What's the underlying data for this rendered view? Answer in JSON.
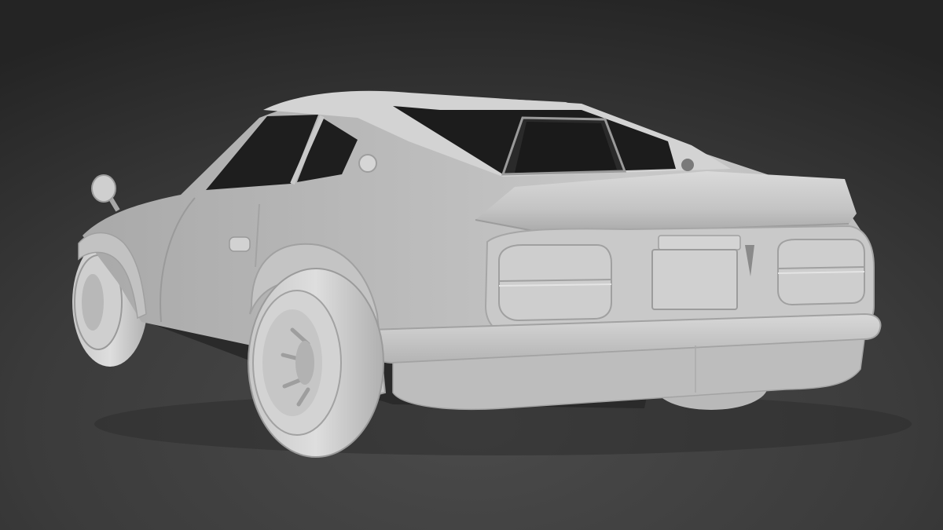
{
  "scene": {
    "subject": "car-model-render",
    "colors": {
      "background_top": "#242424",
      "background_mid": "#3b3b3b",
      "background_bottom": "#4a4a4a",
      "body_light": "#d6d6d6",
      "body_mid": "#bdbdbd",
      "body_shadow": "#8e8e8e",
      "glass_dark": "#1c1c1c",
      "undercarriage": "#2a2a2a"
    }
  }
}
